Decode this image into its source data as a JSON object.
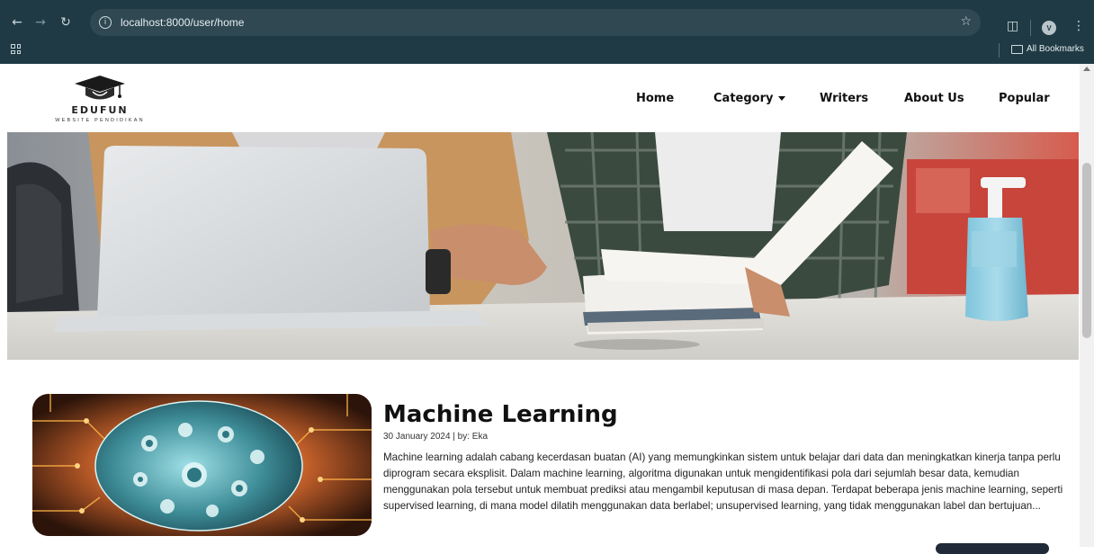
{
  "browser": {
    "url": "localhost:8000/user/home",
    "bookmarks_label": "All Bookmarks",
    "profile_initial": "V",
    "icons": [
      "back-arrow-icon",
      "forward-arrow-icon",
      "reload-icon",
      "info-icon",
      "star-icon",
      "extensions-icon",
      "kebab-menu-icon",
      "apps-grid-icon",
      "folder-icon"
    ]
  },
  "site": {
    "logo_name": "EDUFUN",
    "logo_tagline": "WEBSITE PENDIDIKAN",
    "nav": {
      "home": "Home",
      "category": "Category",
      "writers": "Writers",
      "about": "About Us",
      "popular": "Popular"
    }
  },
  "article": {
    "title": "Machine Learning",
    "meta": "30 January 2024 | by: Eka",
    "excerpt": "Machine learning adalah cabang kecerdasan buatan (AI) yang memungkinkan sistem untuk belajar dari data dan meningkatkan kinerja tanpa perlu diprogram secara eksplisit. Dalam machine learning, algoritma digunakan untuk mengidentifikasi pola dari sejumlah besar data, kemudian menggunakan pola tersebut untuk membuat prediksi atau mengambil keputusan di masa depan. Terdapat beberapa jenis machine learning, seperti supervised learning, di mana model dilatih menggunakan data berlabel; unsupervised learning, yang tidak menggunakan label dan bertujuan..."
  },
  "colors": {
    "chrome_bg": "#1f3a44",
    "omnibox_bg": "#2f4852",
    "text_dark": "#111111"
  }
}
